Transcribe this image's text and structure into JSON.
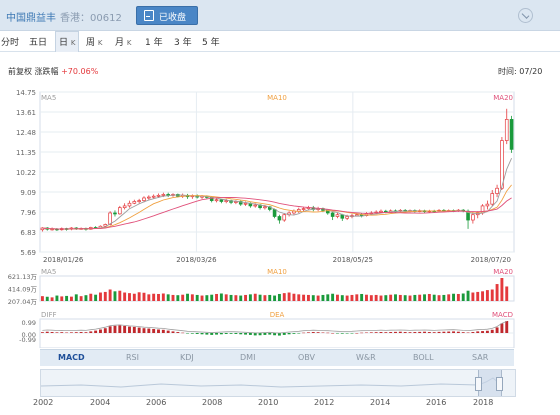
{
  "header": {
    "stock_name": "中国鼎益丰",
    "market_code": "香港：00612",
    "status_button": "已收盘"
  },
  "period_tabs": [
    {
      "label": "分时",
      "suffix": ""
    },
    {
      "label": "五日",
      "suffix": ""
    },
    {
      "label": "日",
      "suffix": "K"
    },
    {
      "label": "周",
      "suffix": "K"
    },
    {
      "label": "月",
      "suffix": "K"
    },
    {
      "label": "1",
      "suffix": "年"
    },
    {
      "label": "3",
      "suffix": "年"
    },
    {
      "label": "5",
      "suffix": "年"
    }
  ],
  "active_period": "日K",
  "info": {
    "adjust_label": "前复权",
    "change_label": "涨跌幅",
    "change_value": "+70.06%",
    "time_label": "时间: 07/20"
  },
  "indicator_tabs": [
    "MACD",
    "RSI",
    "KDJ",
    "DMI",
    "OBV",
    "W&R",
    "BOLL",
    "SAR"
  ],
  "active_indicator": "MACD",
  "navigator_years": [
    "2002",
    "2004",
    "2006",
    "2008",
    "2010",
    "2012",
    "2014",
    "2016",
    "2018"
  ],
  "colors": {
    "up": "#e4393c",
    "down": "#1a9a3b",
    "ma5": "#9e9e9e",
    "ma10": "#f0a040",
    "ma20": "#e0507a",
    "accent": "#3c78b4"
  },
  "chart_data": {
    "type": "candlestick",
    "price_axis_ticks": [
      "14.75",
      "13.61",
      "12.48",
      "11.35",
      "10.22",
      "9.09",
      "7.96",
      "6.83",
      "5.69"
    ],
    "price_range": [
      5.69,
      14.75
    ],
    "date_ticks": [
      "2018/01/26",
      "2018/03/26",
      "2018/05/25",
      "2018/07/20"
    ],
    "ma_labels": [
      "MA5",
      "MA10",
      "MA20"
    ],
    "volume_ticks": [
      "621.13万",
      "414.09万",
      "207.04万"
    ],
    "volume_labels": [
      "MA5",
      "MA10",
      "MA20"
    ],
    "macd_ticks": [
      "0.99",
      "0.00",
      "-0.99"
    ],
    "macd_labels": [
      "DIFF",
      "DEA",
      "MACD"
    ],
    "candles": [
      [
        6.95,
        7.05,
        6.85,
        7.1
      ],
      [
        7.05,
        6.98,
        6.9,
        7.1
      ],
      [
        6.98,
        7.0,
        6.9,
        7.08
      ],
      [
        7.0,
        6.95,
        6.88,
        7.05
      ],
      [
        6.95,
        7.02,
        6.9,
        7.08
      ],
      [
        7.02,
        6.98,
        6.9,
        7.06
      ],
      [
        6.98,
        7.05,
        6.92,
        7.1
      ],
      [
        7.05,
        7.0,
        6.94,
        7.1
      ],
      [
        7.0,
        7.03,
        6.95,
        7.08
      ],
      [
        7.03,
        6.98,
        6.9,
        7.07
      ],
      [
        6.98,
        7.08,
        6.95,
        7.12
      ],
      [
        7.08,
        7.05,
        7.0,
        7.15
      ],
      [
        7.05,
        7.15,
        7.0,
        7.2
      ],
      [
        7.15,
        7.25,
        7.1,
        7.3
      ],
      [
        7.25,
        7.9,
        7.2,
        8.0
      ],
      [
        7.9,
        7.85,
        7.7,
        8.05
      ],
      [
        7.85,
        8.2,
        7.8,
        8.3
      ],
      [
        8.2,
        8.3,
        8.1,
        8.45
      ],
      [
        8.3,
        8.45,
        8.2,
        8.6
      ],
      [
        8.45,
        8.55,
        8.4,
        8.65
      ],
      [
        8.55,
        8.6,
        8.45,
        8.7
      ],
      [
        8.6,
        8.75,
        8.5,
        8.85
      ],
      [
        8.75,
        8.8,
        8.65,
        8.9
      ],
      [
        8.8,
        8.85,
        8.7,
        8.95
      ],
      [
        8.85,
        8.9,
        8.75,
        9.0
      ],
      [
        8.9,
        8.95,
        8.8,
        9.05
      ],
      [
        8.95,
        8.9,
        8.8,
        9.05
      ],
      [
        8.9,
        8.95,
        8.82,
        9.02
      ],
      [
        8.95,
        8.85,
        8.78,
        9.0
      ],
      [
        8.85,
        8.9,
        8.75,
        9.0
      ],
      [
        8.9,
        8.82,
        8.7,
        8.98
      ],
      [
        8.82,
        8.88,
        8.7,
        8.95
      ],
      [
        8.88,
        8.8,
        8.72,
        8.95
      ],
      [
        8.8,
        8.85,
        8.7,
        8.92
      ],
      [
        8.85,
        8.78,
        8.68,
        8.9
      ],
      [
        8.78,
        8.6,
        8.5,
        8.85
      ],
      [
        8.6,
        8.65,
        8.5,
        8.75
      ],
      [
        8.65,
        8.55,
        8.45,
        8.7
      ],
      [
        8.55,
        8.6,
        8.45,
        8.7
      ],
      [
        8.6,
        8.5,
        8.4,
        8.65
      ],
      [
        8.5,
        8.55,
        8.4,
        8.62
      ],
      [
        8.55,
        8.4,
        8.3,
        8.6
      ],
      [
        8.4,
        8.45,
        8.3,
        8.55
      ],
      [
        8.45,
        8.3,
        8.2,
        8.5
      ],
      [
        8.3,
        8.35,
        8.2,
        8.45
      ],
      [
        8.35,
        8.2,
        8.1,
        8.4
      ],
      [
        8.2,
        8.25,
        8.1,
        8.35
      ],
      [
        8.25,
        8.1,
        8.0,
        8.3
      ],
      [
        8.1,
        7.7,
        7.6,
        8.15
      ],
      [
        7.7,
        7.5,
        7.3,
        7.8
      ],
      [
        7.5,
        7.8,
        7.4,
        7.9
      ],
      [
        7.8,
        7.9,
        7.7,
        8.0
      ],
      [
        7.9,
        8.0,
        7.8,
        8.1
      ],
      [
        8.0,
        8.1,
        7.9,
        8.2
      ],
      [
        8.1,
        8.15,
        8.0,
        8.25
      ],
      [
        8.15,
        8.2,
        8.05,
        8.3
      ],
      [
        8.2,
        8.1,
        8.0,
        8.3
      ],
      [
        8.1,
        8.15,
        8.0,
        8.25
      ],
      [
        8.15,
        8.05,
        7.95,
        8.2
      ],
      [
        8.05,
        7.9,
        7.8,
        8.1
      ],
      [
        7.9,
        7.7,
        7.5,
        7.95
      ],
      [
        7.7,
        7.8,
        7.6,
        7.9
      ],
      [
        7.8,
        7.6,
        7.45,
        7.85
      ],
      [
        7.6,
        7.7,
        7.5,
        7.8
      ],
      [
        7.7,
        7.75,
        7.6,
        7.85
      ],
      [
        7.75,
        7.8,
        7.7,
        7.9
      ],
      [
        7.8,
        7.75,
        7.65,
        7.88
      ],
      [
        7.75,
        7.85,
        7.7,
        7.95
      ],
      [
        7.85,
        7.9,
        7.8,
        8.0
      ],
      [
        7.9,
        7.95,
        7.85,
        8.05
      ],
      [
        7.95,
        8.0,
        7.9,
        8.1
      ],
      [
        8.0,
        7.95,
        7.88,
        8.08
      ],
      [
        7.95,
        8.02,
        7.9,
        8.1
      ],
      [
        8.02,
        8.0,
        7.92,
        8.1
      ],
      [
        8.0,
        8.05,
        7.95,
        8.12
      ],
      [
        8.05,
        8.0,
        7.94,
        8.12
      ],
      [
        8.0,
        8.04,
        7.94,
        8.1
      ],
      [
        8.04,
        8.0,
        7.92,
        8.1
      ],
      [
        8.0,
        8.03,
        7.94,
        8.1
      ],
      [
        8.03,
        7.98,
        7.9,
        8.08
      ],
      [
        7.98,
        8.02,
        7.92,
        8.08
      ],
      [
        8.02,
        8.0,
        7.92,
        8.08
      ],
      [
        8.0,
        8.05,
        7.96,
        8.12
      ],
      [
        8.05,
        8.0,
        7.94,
        8.12
      ],
      [
        8.0,
        8.04,
        7.95,
        8.1
      ],
      [
        8.04,
        8.02,
        7.95,
        8.1
      ],
      [
        8.02,
        8.06,
        7.96,
        8.12
      ],
      [
        8.06,
        8.0,
        7.94,
        8.12
      ],
      [
        8.0,
        7.5,
        7.0,
        8.1
      ],
      [
        7.5,
        7.8,
        7.3,
        7.95
      ],
      [
        7.8,
        7.9,
        7.6,
        8.0
      ],
      [
        7.9,
        8.3,
        7.8,
        8.4
      ],
      [
        8.3,
        8.4,
        8.1,
        8.6
      ],
      [
        8.4,
        9.0,
        8.3,
        9.2
      ],
      [
        9.0,
        9.3,
        8.8,
        9.5
      ],
      [
        9.3,
        12.0,
        9.2,
        12.2
      ],
      [
        12.0,
        13.2,
        11.8,
        13.8
      ],
      [
        13.2,
        11.5,
        11.3,
        13.4
      ]
    ],
    "volumes": [
      40,
      35,
      30,
      45,
      38,
      42,
      36,
      55,
      40,
      48,
      60,
      52,
      70,
      75,
      95,
      80,
      85,
      70,
      65,
      60,
      72,
      68,
      55,
      60,
      58,
      62,
      55,
      50,
      48,
      52,
      60,
      55,
      50,
      45,
      48,
      52,
      58,
      62,
      55,
      50,
      48,
      45,
      50,
      55,
      60,
      52,
      48,
      50,
      45,
      58,
      65,
      70,
      60,
      55,
      52,
      50,
      48,
      45,
      50,
      55,
      60,
      52,
      48,
      45,
      50,
      55,
      58,
      52,
      48,
      50,
      45,
      48,
      52,
      55,
      50,
      48,
      45,
      50,
      52,
      55,
      58,
      52,
      48,
      50,
      55,
      60,
      58,
      62,
      85,
      70,
      75,
      80,
      90,
      95,
      140,
      190,
      120
    ],
    "macd_hist": [
      0.05,
      0.08,
      0.06,
      0.04,
      0.05,
      0.03,
      0.04,
      0.05,
      0.06,
      0.05,
      0.1,
      0.15,
      0.22,
      0.3,
      0.42,
      0.45,
      0.48,
      0.44,
      0.4,
      0.38,
      0.34,
      0.3,
      0.28,
      0.25,
      0.22,
      0.2,
      0.15,
      0.1,
      0.06,
      0.02,
      -0.02,
      -0.04,
      -0.06,
      -0.08,
      -0.1,
      -0.12,
      -0.1,
      -0.08,
      -0.06,
      -0.05,
      -0.06,
      -0.08,
      -0.1,
      -0.12,
      -0.15,
      -0.14,
      -0.12,
      -0.1,
      -0.14,
      -0.16,
      -0.12,
      -0.08,
      -0.05,
      -0.02,
      0.02,
      0.04,
      0.06,
      0.05,
      0.03,
      0.02,
      0.0,
      -0.02,
      -0.04,
      -0.03,
      -0.02,
      0.0,
      0.02,
      0.03,
      0.04,
      0.05,
      0.06,
      0.05,
      0.06,
      0.07,
      0.08,
      0.06,
      0.05,
      0.06,
      0.07,
      0.08,
      0.06,
      0.05,
      0.07,
      0.08,
      0.09,
      0.1,
      0.08,
      0.05,
      0.03,
      0.06,
      0.1,
      0.12,
      0.14,
      0.2,
      0.35,
      0.6,
      0.75
    ]
  }
}
